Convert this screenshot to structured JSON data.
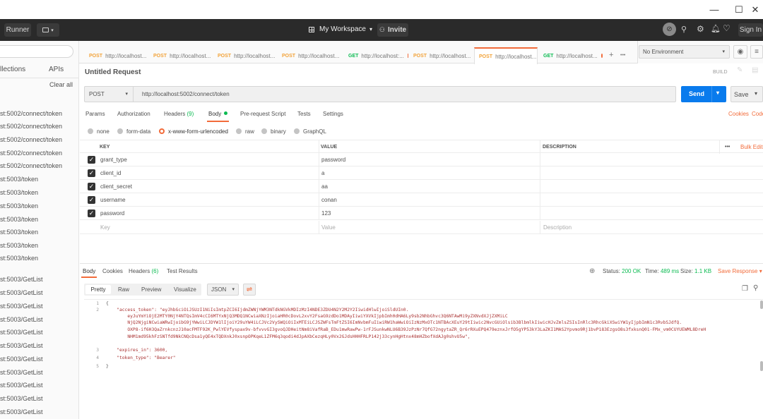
{
  "window": {
    "minimize": "—",
    "maximize": "☐",
    "close": "✕"
  },
  "topbar": {
    "runner": "Runner",
    "workspace": "My Workspace",
    "invite": "Invite",
    "signin": "Sign In"
  },
  "sidebar": {
    "tab_collections": "llections",
    "tab_apis": "APIs",
    "clear_all": "Clear all",
    "items": [
      "st:5002/connect/token",
      "st:5002/connect/token",
      "st:5002/connect/token",
      "st:5002/connect/token",
      "st:5002/connect/token",
      "st:5003/token",
      "st:5003/token",
      "st:5003/token",
      "st:5003/token",
      "st:5003/token",
      "st:5003/token",
      "st:5003/token",
      "st:5003/GetList",
      "st:5003/GetList",
      "st:5003/GetList",
      "st:5003/GetList",
      "st:5003/GetList",
      "st:5003/GetList",
      "st:5003/GetList",
      "st:5003/GetList",
      "st:5003/GetList",
      "st:5003/GetList",
      "st:5003/GetList"
    ]
  },
  "tabs": [
    {
      "method": "POST",
      "url": "http://localhost..."
    },
    {
      "method": "POST",
      "url": "http://localhost..."
    },
    {
      "method": "POST",
      "url": "http://localhost..."
    },
    {
      "method": "POST",
      "url": "http://localhost..."
    },
    {
      "method": "GET",
      "url": "http://localhost:..."
    },
    {
      "method": "POST",
      "url": "http://localhost..."
    },
    {
      "method": "POST",
      "url": "http://localhost..."
    },
    {
      "method": "GET",
      "url": "http://localhost..."
    }
  ],
  "tab_actions": {
    "add": "+",
    "more": "•••"
  },
  "environment": {
    "selected": "No Environment"
  },
  "request": {
    "title": "Untitled Request",
    "build": "BUILD",
    "method": "POST",
    "url": "http://localhost:5002/connect/token",
    "send": "Send",
    "save": "Save"
  },
  "req_tabs": {
    "params": "Params",
    "auth": "Authorization",
    "headers": "Headers",
    "headers_count": "(9)",
    "body": "Body",
    "prerequest": "Pre-request Script",
    "tests": "Tests",
    "settings": "Settings",
    "cookies": "Cookies",
    "code": "Code"
  },
  "body_types": [
    "none",
    "form-data",
    "x-www-form-urlencoded",
    "raw",
    "binary",
    "GraphQL"
  ],
  "kv": {
    "headers": {
      "key": "KEY",
      "value": "VALUE",
      "desc": "DESCRIPTION",
      "more": "•••",
      "bulk": "Bulk Edit"
    },
    "rows": [
      {
        "key": "grant_type",
        "value": "password"
      },
      {
        "key": "client_id",
        "value": "a"
      },
      {
        "key": "client_secret",
        "value": "aa"
      },
      {
        "key": "username",
        "value": "conan"
      },
      {
        "key": "password",
        "value": "123"
      }
    ],
    "placeholder": {
      "key": "Key",
      "value": "Value",
      "desc": "Description"
    }
  },
  "response": {
    "tabs": {
      "body": "Body",
      "cookies": "Cookies",
      "headers": "Headers",
      "headers_count": "(6)",
      "tests": "Test Results"
    },
    "status_label": "Status:",
    "status": "200 OK",
    "time_label": "Time:",
    "time": "489 ms",
    "size_label": "Size:",
    "size": "1.1 KB",
    "save": "Save Response",
    "views": {
      "pretty": "Pretty",
      "raw": "Raw",
      "preview": "Preview",
      "visualize": "Visualize",
      "format": "JSON"
    },
    "lines": [
      {
        "n": "1",
        "t": "{"
      },
      {
        "n": "2",
        "t": "    \"access_token\": \"eyJhbGciOiJSUzI1NiIsImtpZCI6IjdmZWNjYWM3NTdkNGVkMDIzMzI4NDE3ZDU4N2Y2M2Y2IiwidHlwIjoiSldUIn0."
      },
      {
        "n": "",
        "t": "        eyJuYmYiOjE2MTY0NjY4NTQsImV4cCI6MTYxNjQ3MDQ1NCwiaXNzIjoiaHR0cDovL2xvY2FsaG9zdDo1MDAyIiwiYXVkIjpbImh0dHA6Ly9sb2NhbGhvc3Q6NTAwMi9yZXNvdXJjZXMiLC"
      },
      {
        "n": "",
        "t": "        NjQ2NjgiNCwiaWRwIjoibG9jYWwiLCJDYW1lIjoiY29uYW4iLCJVc2VySWQiOiIxMTEiLCJSZWFsTmFtZSI6ImNvbmFuIiwiRW1haWwiOiIzNzMxOTc1NTBAcXEuY29tIiwic2NvcGUiOlsib3BlbmlkIiwicHJvZmlsZSIsInRlc3RhcGkiXSwiYW1yIjpbImN1c3RvbSJdfQ."
      },
      {
        "n": "",
        "t": "        OXP8-if6H3QaZrnkcnzJ10acFMTF92K_PwlYEVfyspax9v-bfvvvGI3gvoQJDHeitNm8iVafRaB_EDu1mwRawPw-1rFJSunkwNLU6B39JzPzNr7QfG72ngytaZR_Qr6rRXuEPQ479eznxJrfO5gYP53kY3LaZKI1MAS2Ypvmo9Rj1bvP183EzgsO8s3fxksnQ01-FMx_vm0CUYUEWML8DreH"
      },
      {
        "n": "",
        "t": "        NHM1md95khFzSNTfd9NkCNQcDsa1yQE4xTQDXnkJ0xsnpOPKqeL1ZFM6q3qodi4dJpAXbCezqHLy0Vx2GJdsHHHFRLP142j33cynHgHtnx48mHZbofXdAJg0shvU5w\","
      },
      {
        "n": "3",
        "t": "    \"expires_in\": 3600,"
      },
      {
        "n": "4",
        "t": "    \"token_type\": \"Bearer\""
      },
      {
        "n": "5",
        "t": "}"
      }
    ]
  },
  "colors": {
    "accent": "#f26b3a",
    "send": "#097bed",
    "status": "#0cbb52",
    "dark": "#2a2a2a"
  }
}
